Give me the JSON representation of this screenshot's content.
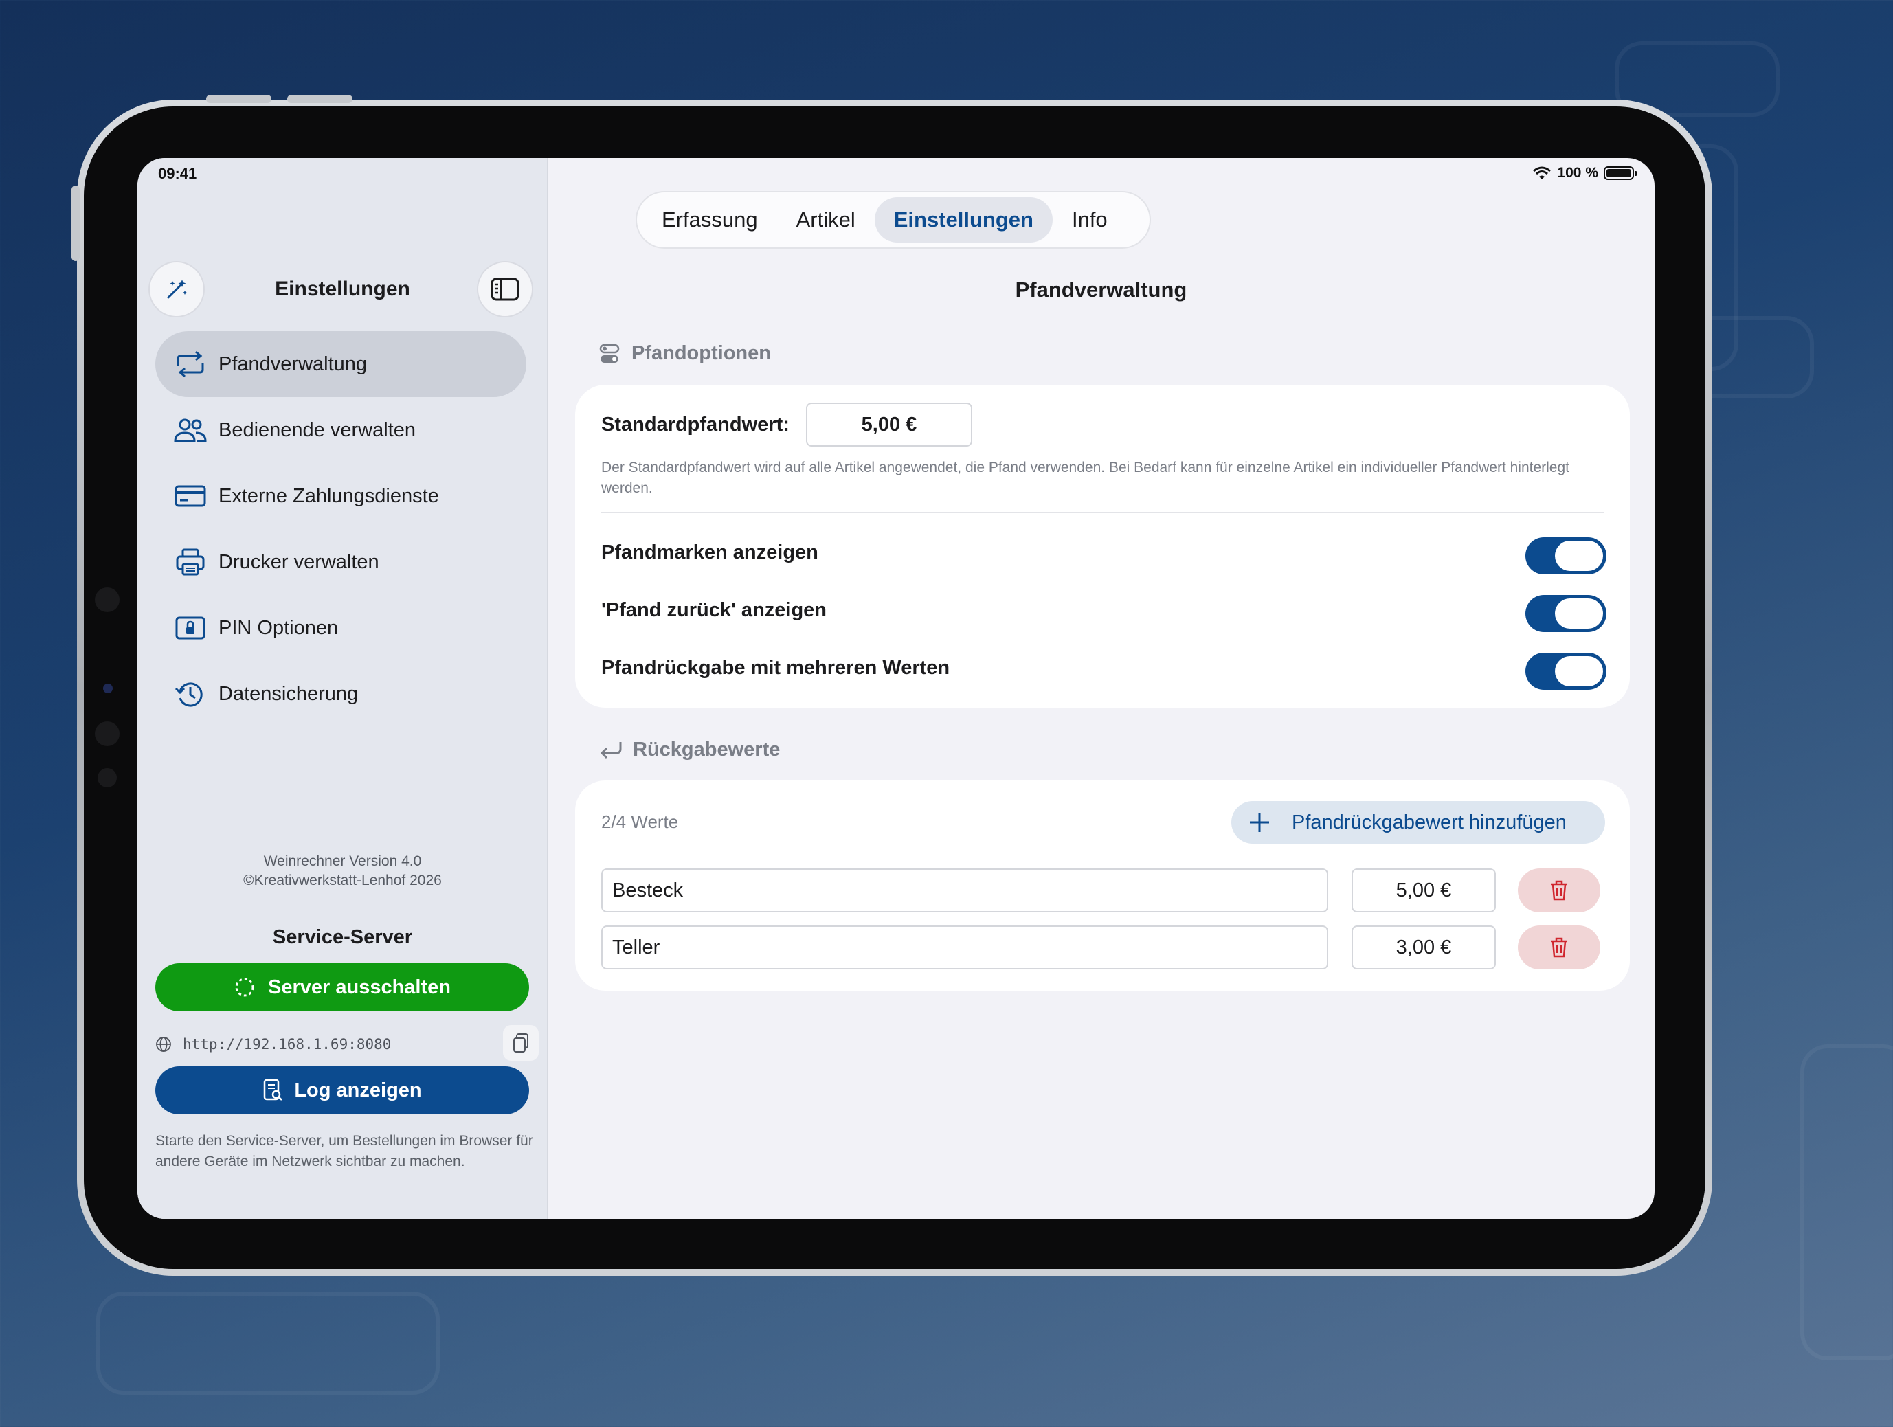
{
  "status": {
    "time": "09:41",
    "battery": "100 %"
  },
  "sidebar": {
    "title": "Einstellungen",
    "items": [
      {
        "label": "Pfandverwaltung",
        "icon": "arrows-cycle-icon",
        "active": true
      },
      {
        "label": "Bedienende verwalten",
        "icon": "people-icon"
      },
      {
        "label": "Externe Zahlungsdienste",
        "icon": "credit-card-icon"
      },
      {
        "label": "Drucker verwalten",
        "icon": "printer-icon"
      },
      {
        "label": "PIN Optionen",
        "icon": "lock-icon"
      },
      {
        "label": "Datensicherung",
        "icon": "backup-clock-icon"
      }
    ],
    "version_line1": "Weinrechner Version 4.0",
    "version_line2": "©Kreativwerkstatt-Lenhof 2026",
    "server": {
      "title": "Service-Server",
      "toggle_label": "Server ausschalten",
      "url": "http://192.168.1.69:8080",
      "log_label": "Log anzeigen",
      "hint": "Starte den Service-Server, um Bestellungen im Browser für andere Geräte im Netzwerk sichtbar zu machen."
    }
  },
  "tabs": [
    {
      "label": "Erfassung"
    },
    {
      "label": "Artikel"
    },
    {
      "label": "Einstellungen",
      "active": true
    },
    {
      "label": "Info"
    }
  ],
  "main": {
    "title": "Pfandverwaltung",
    "options_section": {
      "title": "Pfandoptionen",
      "default_label": "Standardpfandwert:",
      "default_value": "5,00 €",
      "default_hint": "Der Standardpfandwert wird auf alle Artikel angewendet, die Pfand verwenden. Bei Bedarf kann für einzelne Artikel ein individueller Pfandwert hinterlegt werden.",
      "toggles": [
        {
          "label": "Pfandmarken anzeigen",
          "on": true
        },
        {
          "label": "'Pfand zurück' anzeigen",
          "on": true
        },
        {
          "label": "Pfandrückgabe mit mehreren Werten",
          "on": true
        }
      ]
    },
    "return_section": {
      "title": "Rückgabewerte",
      "count": "2/4 Werte",
      "add_label": "Pfandrückgabewert hinzufügen",
      "items": [
        {
          "name": "Besteck",
          "value": "5,00 €"
        },
        {
          "name": "Teller",
          "value": "3,00 €"
        }
      ]
    }
  },
  "colors": {
    "accent": "#0c4b8f",
    "server_on": "#0f9a12",
    "delete_bg": "#f1d5d6",
    "delete_icon": "#d0262e"
  }
}
